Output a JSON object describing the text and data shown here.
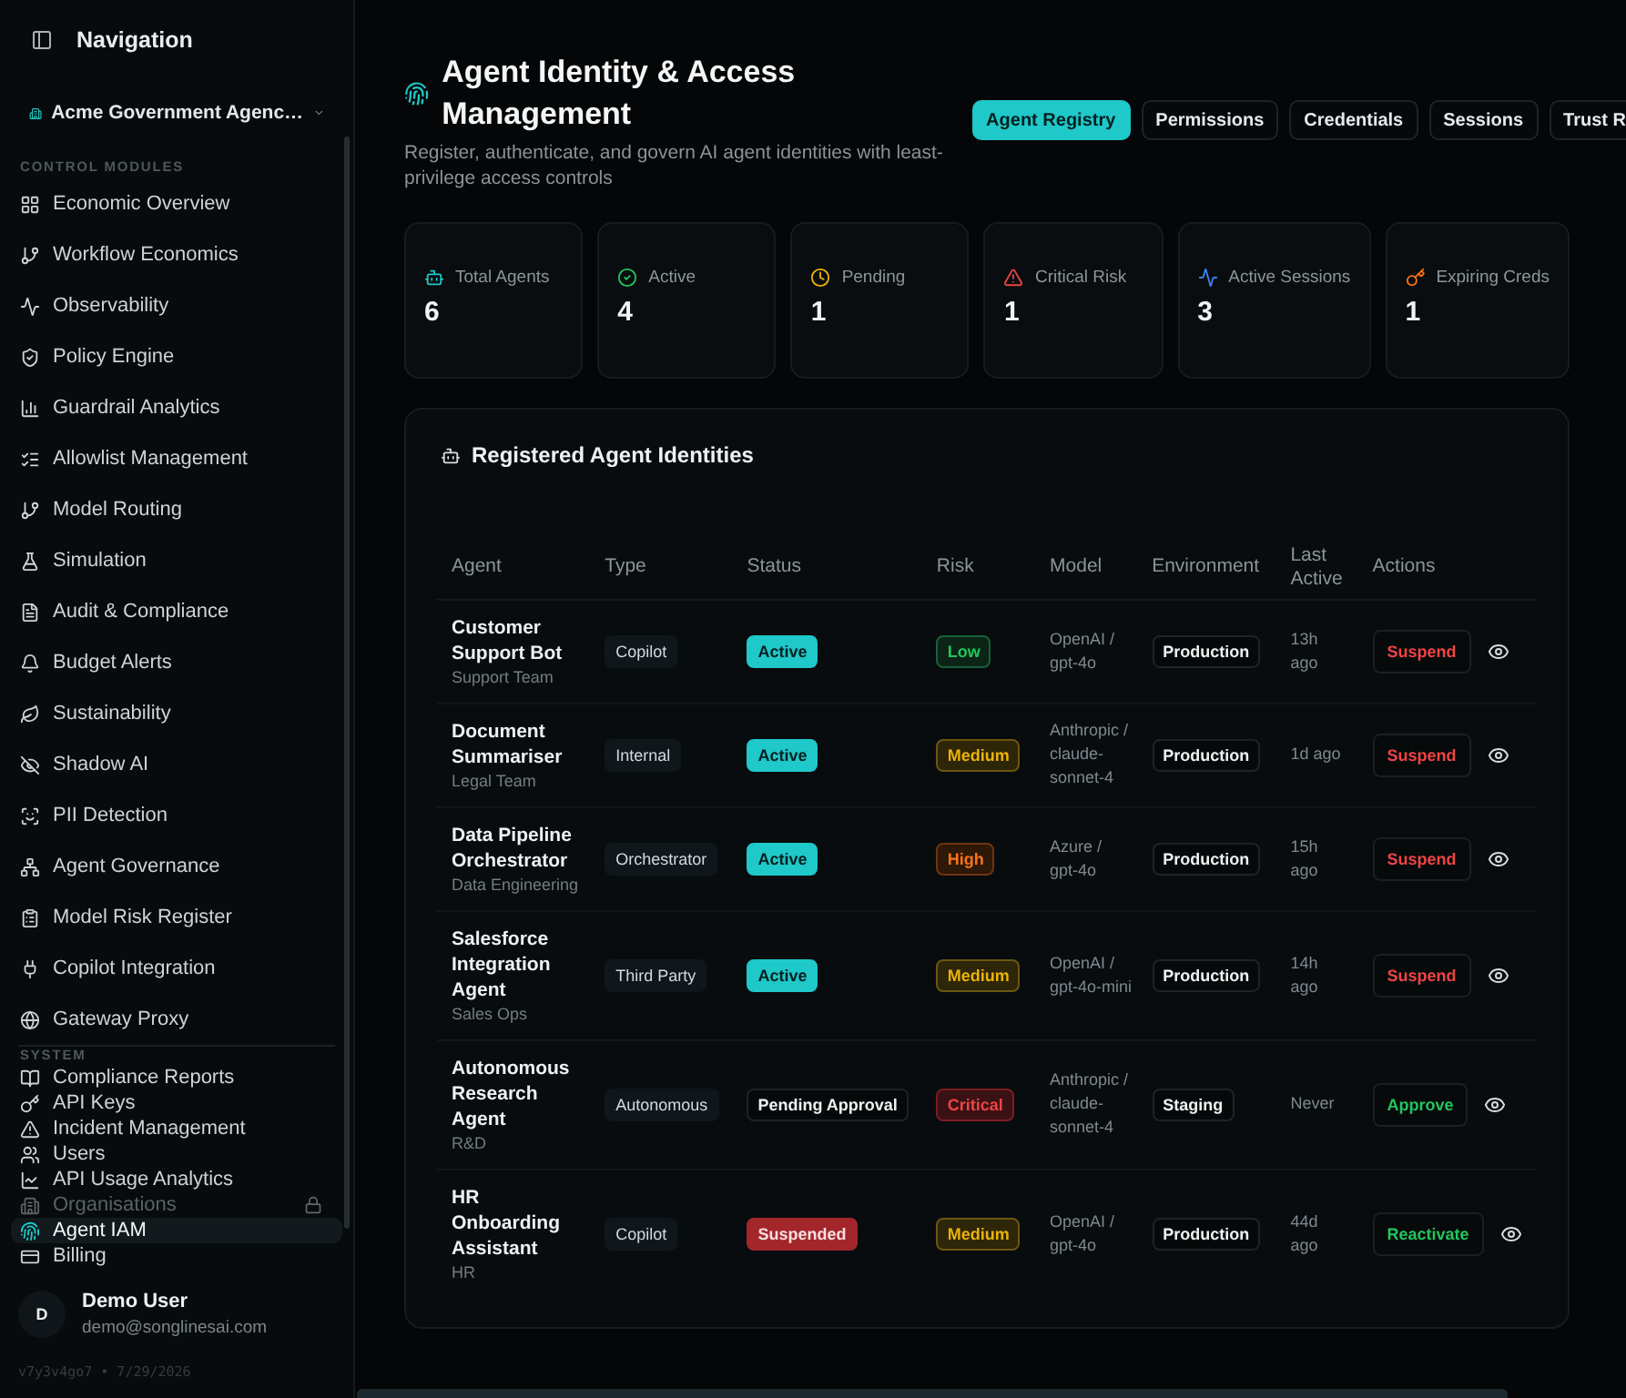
{
  "sidebar": {
    "title": "Navigation",
    "organization": "Acme Government Agenc…",
    "sections": [
      {
        "label": "CONTROL MODULES",
        "items": [
          {
            "label": "Economic Overview",
            "selected": false
          },
          {
            "label": "Workflow Economics",
            "selected": false
          },
          {
            "label": "Observability",
            "selected": false
          },
          {
            "label": "Policy Engine",
            "selected": false
          },
          {
            "label": "Guardrail Analytics",
            "selected": false
          },
          {
            "label": "Allowlist Management",
            "selected": false
          },
          {
            "label": "Model Routing",
            "selected": false
          },
          {
            "label": "Simulation",
            "selected": false
          },
          {
            "label": "Audit & Compliance",
            "selected": false
          },
          {
            "label": "Budget Alerts",
            "selected": false
          },
          {
            "label": "Sustainability",
            "selected": false
          },
          {
            "label": "Shadow AI",
            "selected": false
          },
          {
            "label": "PII Detection",
            "selected": false
          },
          {
            "label": "Agent Governance",
            "selected": false
          },
          {
            "label": "Model Risk Register",
            "selected": false
          },
          {
            "label": "Copilot Integration",
            "selected": false
          },
          {
            "label": "Gateway Proxy",
            "selected": false
          }
        ]
      },
      {
        "label": "SYSTEM",
        "items": [
          {
            "label": "Compliance Reports",
            "selected": false,
            "disabled": false
          },
          {
            "label": "API Keys",
            "selected": false,
            "disabled": false
          },
          {
            "label": "Incident Management",
            "selected": false,
            "disabled": false
          },
          {
            "label": "Users",
            "selected": false,
            "disabled": false
          },
          {
            "label": "API Usage Analytics",
            "selected": false,
            "disabled": false
          },
          {
            "label": "Organisations",
            "selected": false,
            "disabled": true
          },
          {
            "label": "Agent IAM",
            "selected": true,
            "disabled": false
          },
          {
            "label": "Billing",
            "selected": false,
            "disabled": false
          }
        ]
      }
    ],
    "user": {
      "initial": "D",
      "name": "Demo User",
      "email": "demo@songlinesai.com"
    },
    "version": "v7y3v4go7 • 7/29/2026"
  },
  "header": {
    "title": "Agent Identity & Access Management",
    "subtitle": "Register, authenticate, and govern AI agent identities with least-privilege access controls"
  },
  "tabs": [
    {
      "label": "Agent Registry",
      "selected": true
    },
    {
      "label": "Permissions",
      "selected": false
    },
    {
      "label": "Credentials",
      "selected": false
    },
    {
      "label": "Sessions",
      "selected": false
    },
    {
      "label": "Trust R",
      "selected": false
    }
  ],
  "stats": [
    {
      "label": "Total Agents",
      "value": "6"
    },
    {
      "label": "Active",
      "value": "4"
    },
    {
      "label": "Pending",
      "value": "1"
    },
    {
      "label": "Critical Risk",
      "value": "1"
    },
    {
      "label": "Active Sessions",
      "value": "3"
    },
    {
      "label": "Expiring Creds",
      "value": "1"
    }
  ],
  "registry": {
    "title": "Registered Agent Identities",
    "columns": [
      "Agent",
      "Type",
      "Status",
      "Risk",
      "Model",
      "Environment",
      "Last Active",
      "Actions"
    ],
    "rows": [
      {
        "name": "Customer Support Bot",
        "team": "Support Team",
        "type": "Copilot",
        "status": {
          "label": "Active",
          "kind": "active"
        },
        "risk": {
          "label": "Low",
          "kind": "low"
        },
        "model": "OpenAI / gpt-4o",
        "environment": "Production",
        "last_active": "13h ago",
        "action": {
          "label": "Suspend",
          "kind": "suspend"
        }
      },
      {
        "name": "Document Summariser",
        "team": "Legal Team",
        "type": "Internal",
        "status": {
          "label": "Active",
          "kind": "active"
        },
        "risk": {
          "label": "Medium",
          "kind": "medium"
        },
        "model": "Anthropic / claude-sonnet-4",
        "environment": "Production",
        "last_active": "1d ago",
        "action": {
          "label": "Suspend",
          "kind": "suspend"
        }
      },
      {
        "name": "Data Pipeline Orchestrator",
        "team": "Data Engineering",
        "type": "Orchestrator",
        "status": {
          "label": "Active",
          "kind": "active"
        },
        "risk": {
          "label": "High",
          "kind": "high"
        },
        "model": "Azure / gpt-4o",
        "environment": "Production",
        "last_active": "15h ago",
        "action": {
          "label": "Suspend",
          "kind": "suspend"
        }
      },
      {
        "name": "Salesforce Integration Agent",
        "team": "Sales Ops",
        "type": "Third Party",
        "status": {
          "label": "Active",
          "kind": "active"
        },
        "risk": {
          "label": "Medium",
          "kind": "medium"
        },
        "model": "OpenAI / gpt-4o-mini",
        "environment": "Production",
        "last_active": "14h ago",
        "action": {
          "label": "Suspend",
          "kind": "suspend"
        }
      },
      {
        "name": "Autonomous Research Agent",
        "team": "R&D",
        "type": "Autonomous",
        "status": {
          "label": "Pending Approval",
          "kind": "pending"
        },
        "risk": {
          "label": "Critical",
          "kind": "critical"
        },
        "model": "Anthropic / claude-sonnet-4",
        "environment": "Staging",
        "last_active": "Never",
        "action": {
          "label": "Approve",
          "kind": "approve"
        }
      },
      {
        "name": "HR Onboarding Assistant",
        "team": "HR",
        "type": "Copilot",
        "status": {
          "label": "Suspended",
          "kind": "suspended"
        },
        "risk": {
          "label": "Medium",
          "kind": "medium"
        },
        "model": "OpenAI / gpt-4o",
        "environment": "Production",
        "last_active": "44d ago",
        "action": {
          "label": "Reactivate",
          "kind": "reactivate"
        }
      }
    ]
  }
}
